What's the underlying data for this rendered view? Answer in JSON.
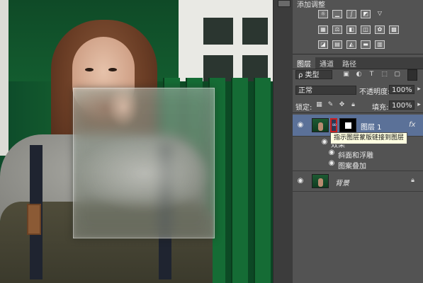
{
  "adjustments_panel": {
    "title": "添加调整"
  },
  "layers_panel": {
    "tabs": [
      "图层",
      "通道",
      "路径"
    ],
    "filter": {
      "kind_label": "ρ 类型",
      "filter_icons": [
        "image-filter-icon",
        "adjustment-filter-icon",
        "type-filter-icon",
        "shape-filter-icon",
        "smartobject-filter-icon"
      ]
    },
    "blend_mode": "正常",
    "opacity_label": "不透明度:",
    "opacity_value": "100%",
    "lock_label": "锁定:",
    "fill_label": "填充:",
    "fill_value": "100%",
    "layers": [
      {
        "name": "图层 1",
        "selected": true,
        "has_mask": true,
        "fx_label": "fx"
      },
      {
        "name": "背景",
        "selected": false,
        "locked": true
      }
    ],
    "effects": [
      "效果",
      "斜面和浮雕",
      "图案叠加"
    ],
    "tooltip": "指示图层蒙版链接到图层"
  },
  "colors": {
    "panel_bg": "#535353",
    "selected_layer": "#5b7198",
    "link_highlight": "#cc1f1f"
  }
}
